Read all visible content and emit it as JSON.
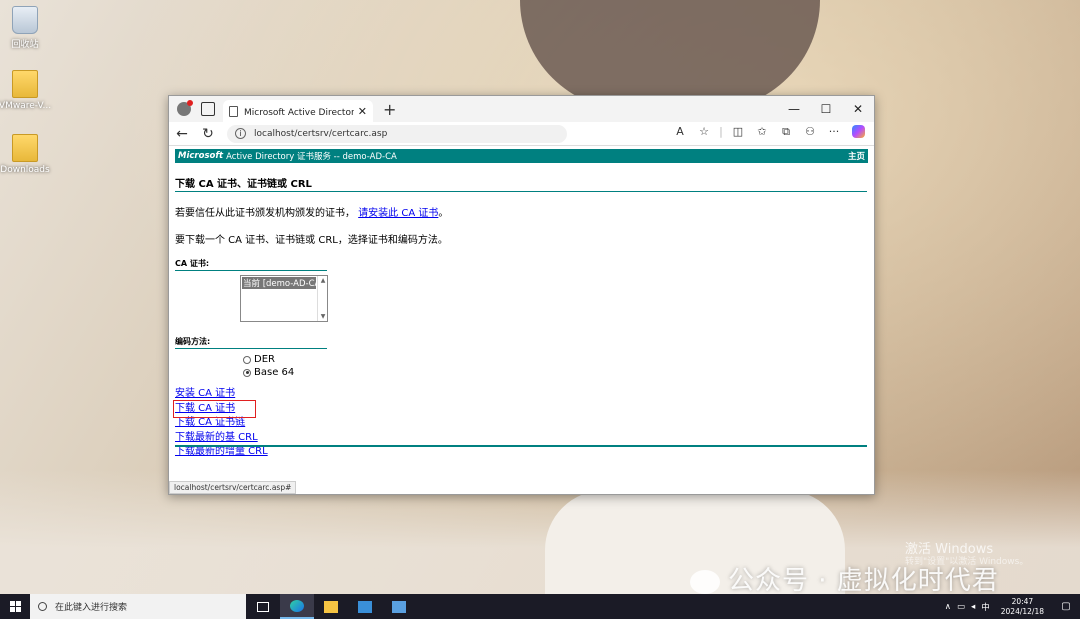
{
  "desktop": {
    "icons": [
      {
        "label": "回收站",
        "icon": "recycle-bin-icon"
      },
      {
        "label": "VMware-V...",
        "icon": "zip-folder-icon"
      },
      {
        "label": "Downloads",
        "icon": "folder-icon"
      }
    ],
    "watermark_line1": "激活 Windows",
    "watermark_line2": "转到\"设置\"以激活 Windows。",
    "wechat_text": "公众号 · 虚拟化时代君"
  },
  "browser": {
    "tab_title": "Microsoft Active Directory 证书服",
    "new_tab": "+",
    "url": "localhost/certsrv/certcarc.asp",
    "window_controls": {
      "minimize": "—",
      "maximize": "☐",
      "close": "✕"
    }
  },
  "page": {
    "header_brand": "Microsoft",
    "header_service": "Active Directory 证书服务  --  demo-AD-CA",
    "header_home": "主页",
    "title": "下载 CA 证书、证书链或 CRL",
    "trust_text": "若要信任从此证书颁发机构颁发的证书，",
    "trust_link": "请安装此 CA 证书",
    "trust_end": "。",
    "instruction": "要下载一个 CA 证书、证书链或 CRL，选择证书和编码方法。",
    "ca_cert_label": "CA 证书:",
    "ca_cert_option": "当前 [demo-AD-CA]",
    "encoding_label": "编码方法:",
    "encodings": [
      "DER",
      "Base 64"
    ],
    "selected_encoding": "Base 64",
    "links": [
      "安装 CA 证书",
      "下载 CA 证书",
      "下载 CA 证书链",
      "下载最新的基 CRL",
      "下载最新的增量 CRL"
    ],
    "status_url": "localhost/certsrv/certcarc.asp#"
  },
  "taskbar": {
    "search_placeholder": "在此键入进行搜索",
    "time": "20:47",
    "date": "2024/12/18",
    "ime": "中"
  }
}
